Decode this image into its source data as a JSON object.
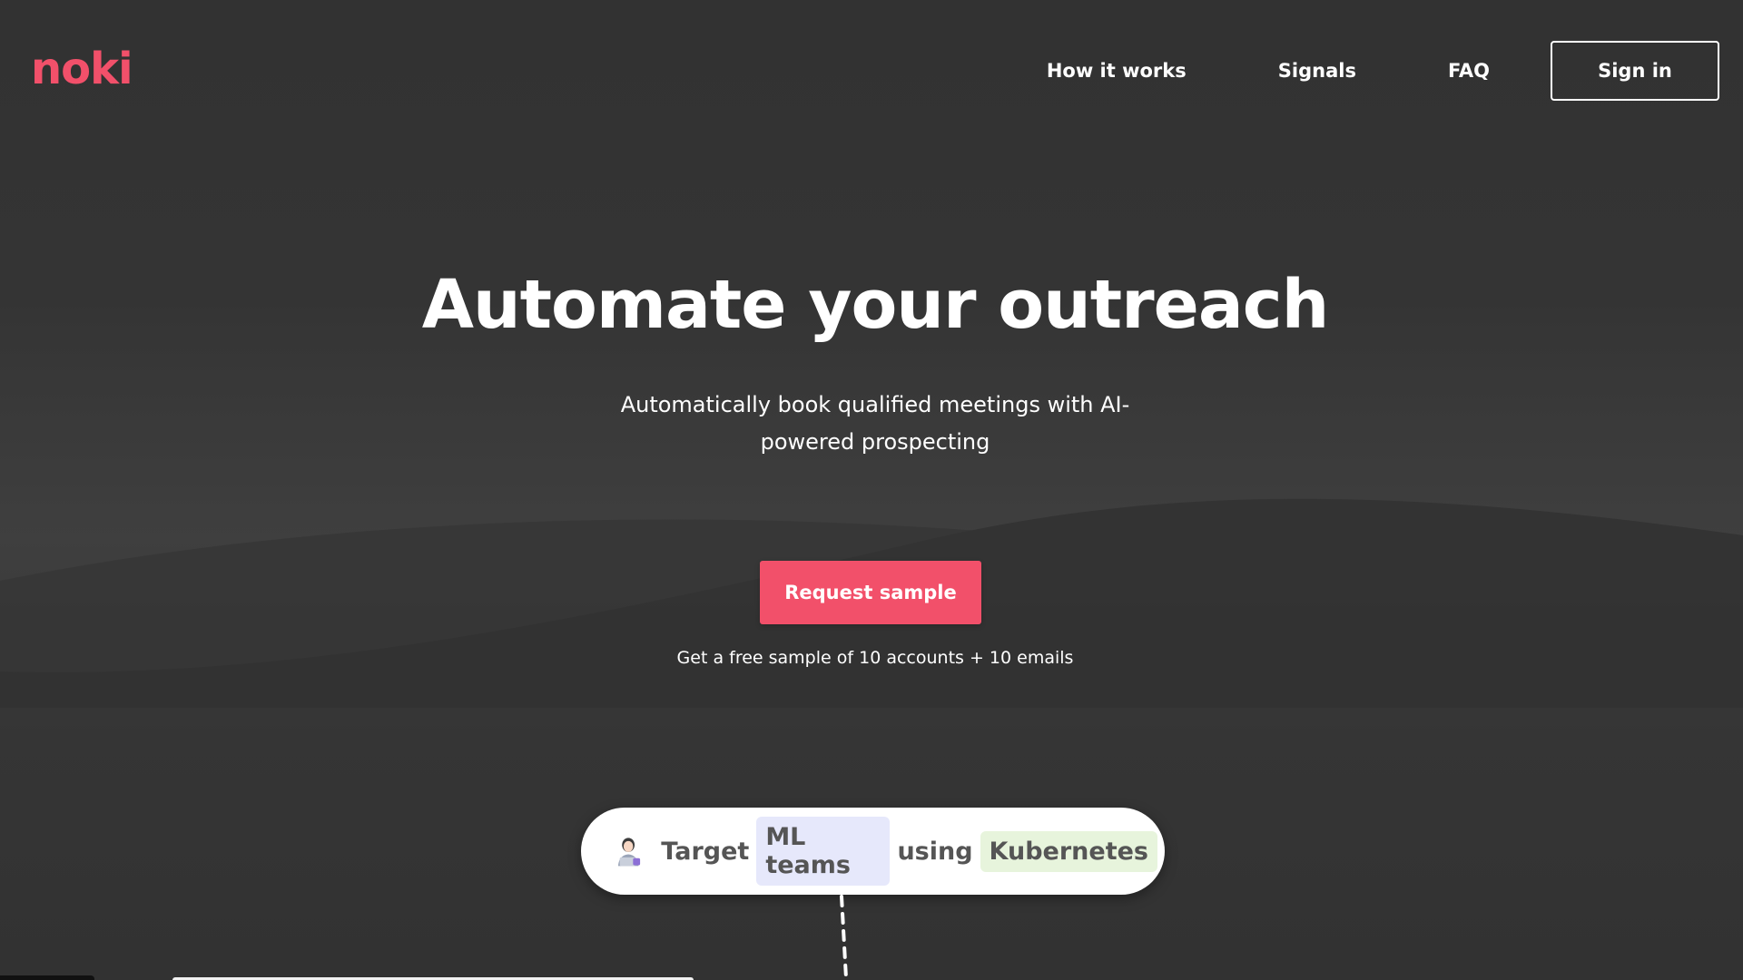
{
  "header": {
    "logo_text": "noki",
    "nav": {
      "how_it_works": "How it works",
      "signals": "Signals",
      "faq": "FAQ"
    },
    "signin_label": "Sign in"
  },
  "hero": {
    "title": "Automate your outreach",
    "subtitle": "Automatically book qualified meetings with AI-powered prospecting",
    "cta_label": "Request sample",
    "cta_note": "Get a free sample of 10 accounts + 10 emails"
  },
  "target_pill": {
    "avatar_icon": "person-with-laptop-icon",
    "word_target": "Target",
    "chip_audience": "ML teams",
    "word_using": "using",
    "chip_technology": "Kubernetes"
  },
  "colors": {
    "brand": "#f2506a",
    "background": "#333333",
    "chip_blue": "#e6e8fb",
    "chip_green": "#e7f4dc"
  }
}
